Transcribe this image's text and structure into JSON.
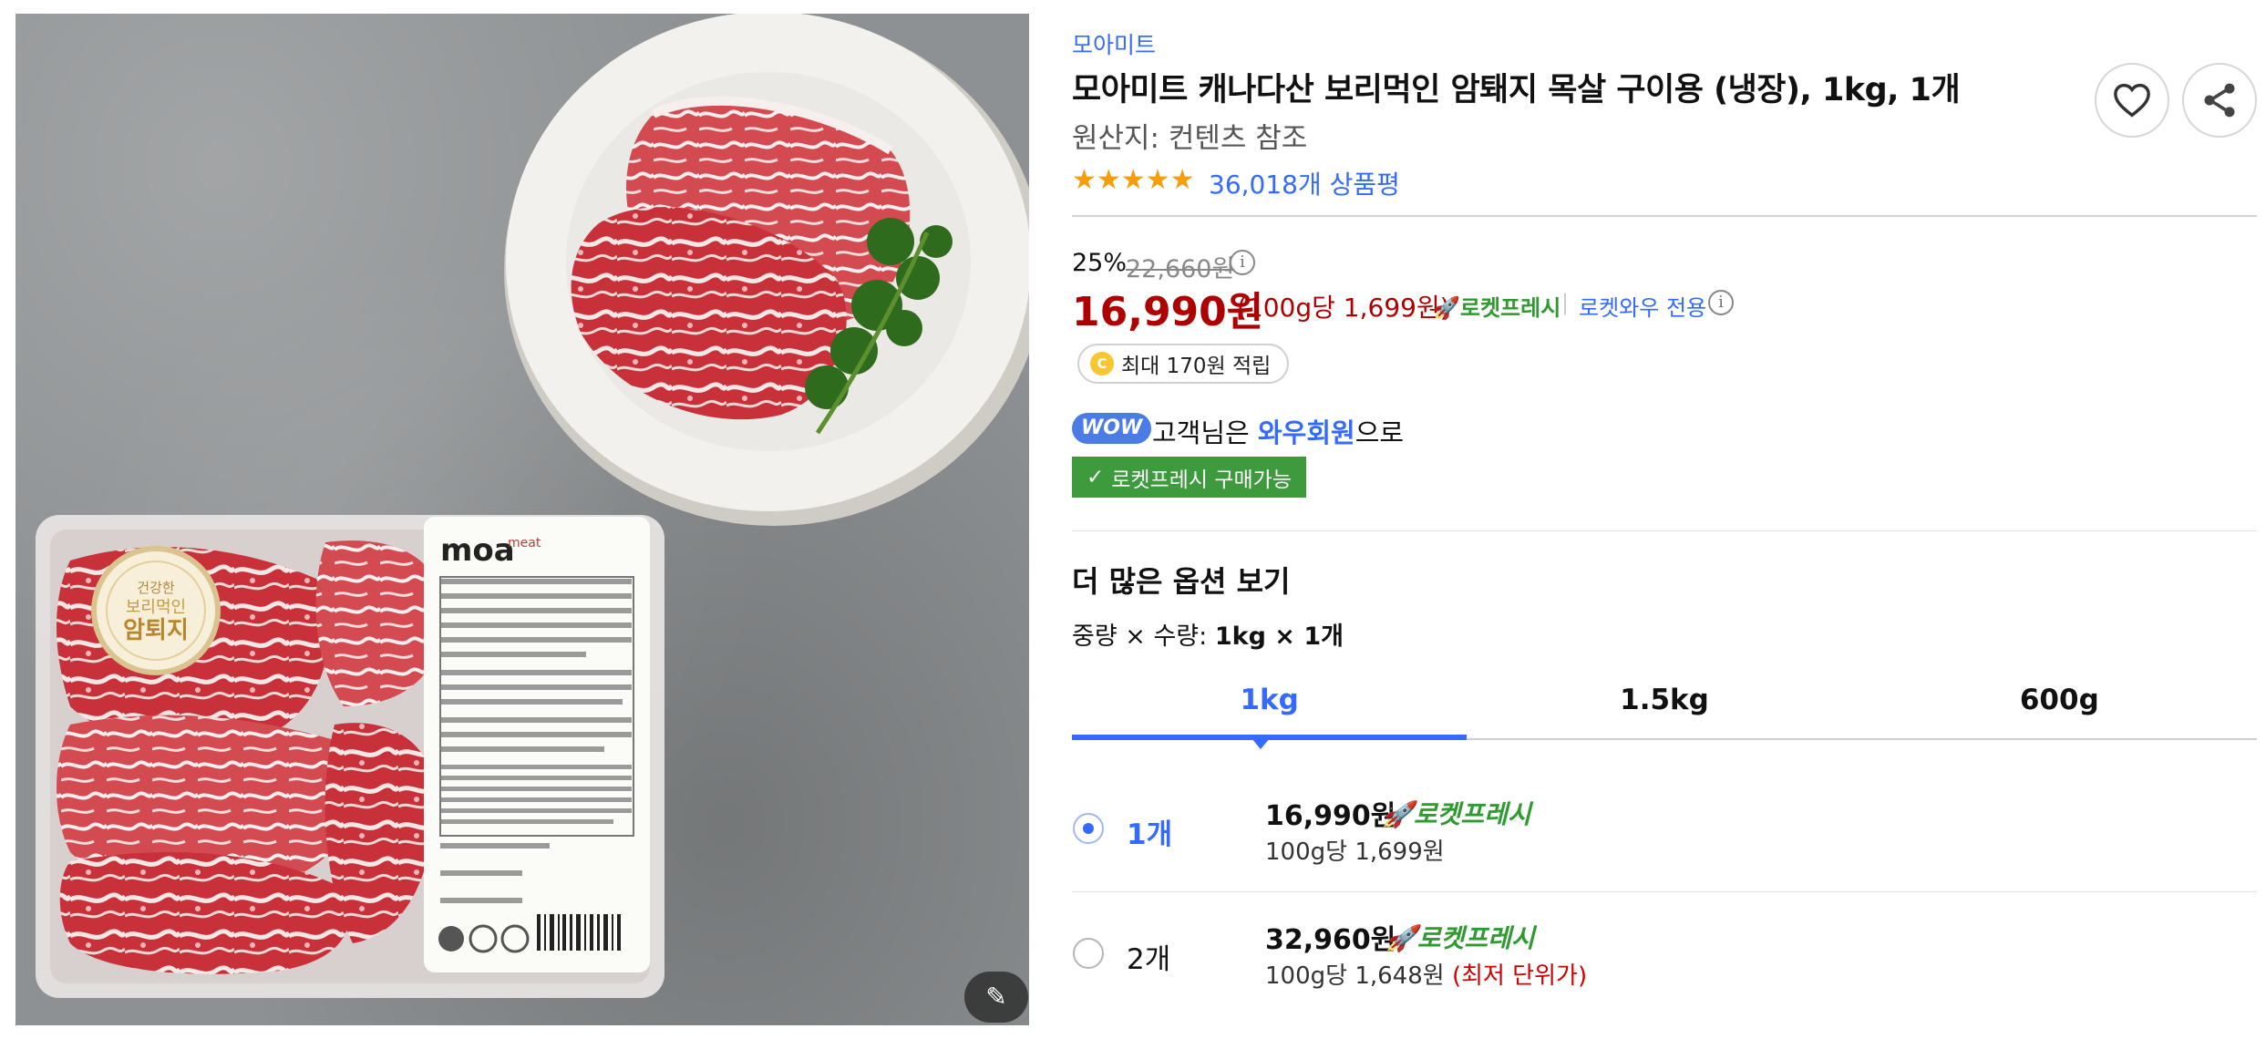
{
  "product_image": {
    "package_logo": "moa",
    "package_logo_sub": "meat",
    "sticker_top": "건강한",
    "sticker_mid": "보리먹인",
    "sticker_bottom": "암퇴지",
    "zoom_icon": "magic-wand-icon"
  },
  "product": {
    "brand": "모아미트",
    "title": "모아미트 캐나다산 보리먹인 암퇘지 목살 구이용 (냉장), 1kg, 1개",
    "origin": "원산지: 컨텐츠 참조",
    "rating": 5,
    "rating_stars": "★★★★★",
    "review_count": "36,018개 상품평"
  },
  "actions": {
    "wishlist_icon": "heart-icon",
    "share_icon": "share-icon"
  },
  "price": {
    "discount_rate": "25%",
    "original_price": "22,660원",
    "original_info_icon": "i",
    "sale_price": "16,990원",
    "unit_price": "(100g당 1,699원)",
    "rocket_fresh": "로켓프레시",
    "separator": "|",
    "wow_only": "로켓와우 전용",
    "wow_info_icon": "i"
  },
  "cashback": {
    "coin": "C",
    "text": "최대 170원 적립"
  },
  "wow": {
    "badge": "WOW",
    "text_before": "고객님은 ",
    "member": "와우회원",
    "text_after": "으로"
  },
  "purchase_badge": {
    "check": "✓",
    "label": "로켓프레시 구매가능"
  },
  "options": {
    "heading": "더 많은 옵션 보기",
    "selected_prefix": "중량 × 수량: ",
    "selected_value": "1kg × 1개",
    "tabs": [
      "1kg",
      "1.5kg",
      "600g"
    ],
    "active_tab": 0,
    "quantities": [
      {
        "qty": "1개",
        "price": "16,990원",
        "rocket": "로켓프레시",
        "unit": "100g당 1,699원",
        "note": "",
        "selected": true
      },
      {
        "qty": "2개",
        "price": "32,960원",
        "rocket": "로켓프레시",
        "unit": "100g당 1,648원",
        "note": "(최저 단위가)",
        "selected": false
      }
    ]
  },
  "colors": {
    "accent_blue": "#346aff",
    "price_red": "#ae0000",
    "rocket_green": "#2f9a2f",
    "wow_blue": "#4b7be5"
  }
}
